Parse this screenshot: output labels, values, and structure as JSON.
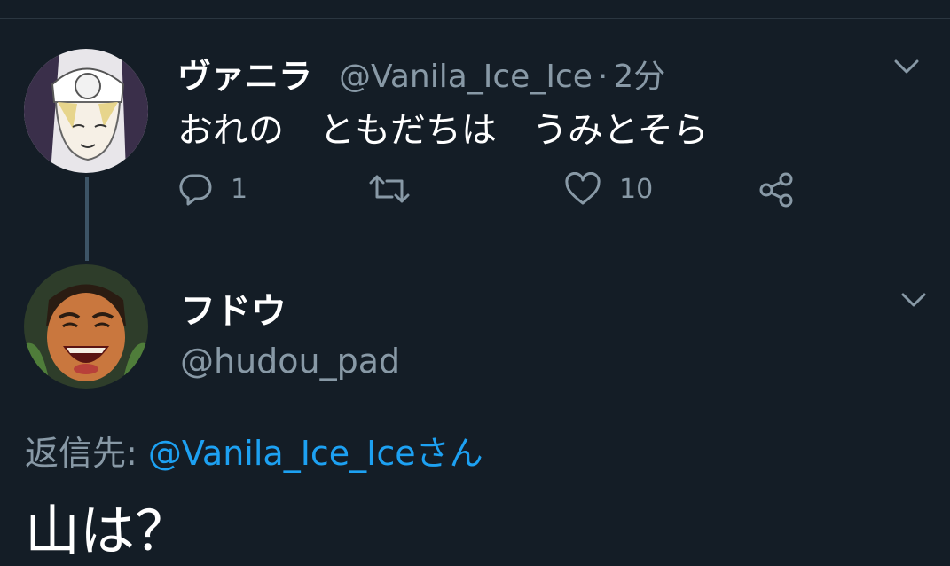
{
  "tweet": {
    "display_name": "ヴァニラ",
    "handle": "@Vanila_Ice_Ice",
    "separator": "·",
    "time": "2分",
    "text": "おれの　ともだちは　うみとそら",
    "reply_count": "1",
    "like_count": "10"
  },
  "reply": {
    "display_name": "フドウ",
    "handle": "@hudou_pad",
    "reply_to_label": "返信先: ",
    "reply_to_mention": "@Vanila_Ice_Iceさん",
    "text": "山は？"
  },
  "icons": {
    "reply": "reply-icon",
    "retweet": "retweet-icon",
    "like": "heart-icon",
    "share": "share-icon",
    "menu": "chevron-down-icon"
  },
  "colors": {
    "background": "#141d26",
    "secondary_text": "#8899a6",
    "link": "#1da1f2",
    "thread_line": "#3d5466"
  }
}
